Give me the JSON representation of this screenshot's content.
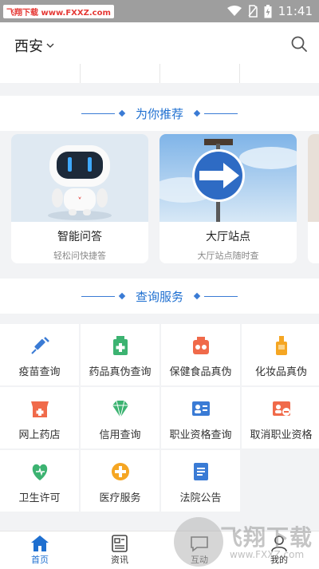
{
  "status_bar": {
    "watermark": "飞翔下载 www.FXXZ.com",
    "time": "11:41"
  },
  "header": {
    "city": "西安"
  },
  "sections": {
    "recommend_title": "为你推荐",
    "query_title": "查询服务"
  },
  "recommend_cards": [
    {
      "title": "智能问答",
      "subtitle": "轻松问快捷答"
    },
    {
      "title": "大厅站点",
      "subtitle": "大厅站点随时查"
    }
  ],
  "services": [
    {
      "label": "疫苗查询",
      "icon": "syringe-icon",
      "color": "#3a7bd5"
    },
    {
      "label": "药品真伪查询",
      "icon": "medicine-box-icon",
      "color": "#3cb371"
    },
    {
      "label": "保健食品真伪",
      "icon": "health-food-icon",
      "color": "#f06a4a"
    },
    {
      "label": "化妆品真伪",
      "icon": "cosmetic-bottle-icon",
      "color": "#f5a623"
    },
    {
      "label": "网上药店",
      "icon": "pharmacy-store-icon",
      "color": "#f06a4a"
    },
    {
      "label": "信用查询",
      "icon": "diamond-icon",
      "color": "#3cb371"
    },
    {
      "label": "职业资格查询",
      "icon": "id-card-icon",
      "color": "#3a7bd5"
    },
    {
      "label": "取消职业资格",
      "icon": "id-card-cancel-icon",
      "color": "#f06a4a"
    },
    {
      "label": "卫生许可",
      "icon": "heart-shield-icon",
      "color": "#3cb371"
    },
    {
      "label": "医疗服务",
      "icon": "medical-cross-icon",
      "color": "#f5a623"
    },
    {
      "label": "法院公告",
      "icon": "document-icon",
      "color": "#3a7bd5"
    }
  ],
  "bottom_nav": [
    {
      "label": "首页",
      "icon": "home-icon",
      "active": true
    },
    {
      "label": "资讯",
      "icon": "news-icon",
      "active": false
    },
    {
      "label": "互动",
      "icon": "interact-icon",
      "active": false
    },
    {
      "label": "我的",
      "icon": "user-icon",
      "active": false
    }
  ],
  "overlay_watermark": {
    "brand": "飞翔下载",
    "url": "www.FXXZ.com"
  },
  "colors": {
    "accent": "#1e6fd0",
    "background": "#f2f3f5"
  }
}
